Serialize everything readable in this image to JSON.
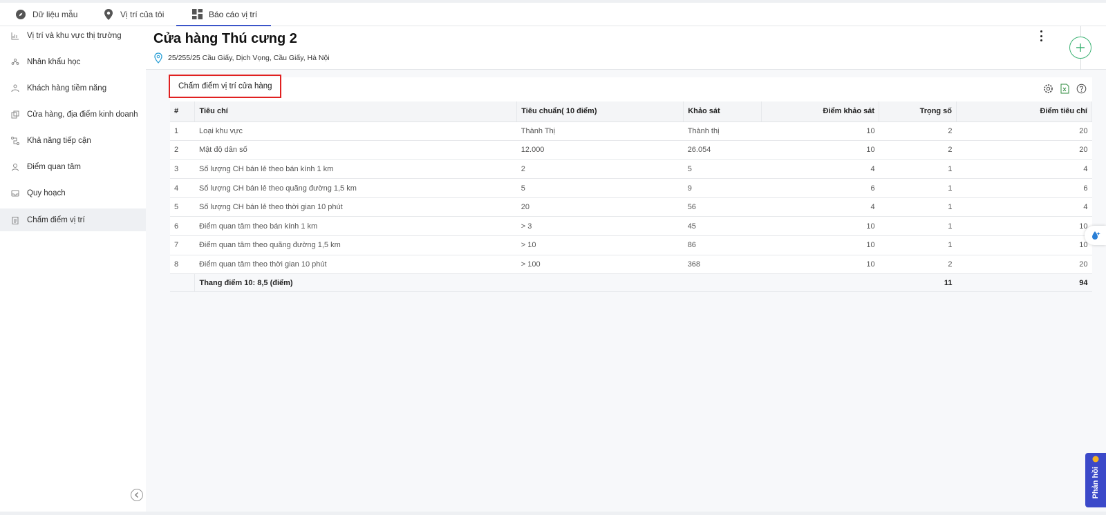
{
  "tabs": [
    {
      "label": "Dữ liệu mẫu",
      "icon": "compass-icon"
    },
    {
      "label": "Vị trí của tôi",
      "icon": "map-pin-icon"
    },
    {
      "label": "Báo cáo vị trí",
      "icon": "dashboard-icon",
      "active": true
    }
  ],
  "sidebar": {
    "items": [
      {
        "label": "Vị trí và khu vực thị trường",
        "icon": "chart-icon"
      },
      {
        "label": "Nhân khẩu học",
        "icon": "people-icon"
      },
      {
        "label": "Khách hàng tiềm năng",
        "icon": "users-icon"
      },
      {
        "label": "Cửa hàng, địa điểm kinh doanh",
        "icon": "store-icon"
      },
      {
        "label": "Khả năng tiếp cận",
        "icon": "route-icon"
      },
      {
        "label": "Điểm quan tâm",
        "icon": "person-icon"
      },
      {
        "label": "Quy hoạch",
        "icon": "inbox-icon"
      },
      {
        "label": "Chấm điểm vị trí",
        "icon": "clipboard-icon",
        "active": true
      }
    ]
  },
  "header": {
    "title": "Cửa hàng Thú cưng 2",
    "address": "25/255/25 Cầu Giấy, Dịch Vọng, Cầu Giấy, Hà Nội"
  },
  "card": {
    "title": "Chấm điểm vị trí cửa hàng",
    "columns": [
      "#",
      "Tiêu chí",
      "Tiêu chuẩn( 10 điểm)",
      "Khảo sát",
      "Điểm khảo sát",
      "Trọng số",
      "Điểm tiêu chí"
    ],
    "rows": [
      {
        "idx": "1",
        "criteria": "Loại khu vực",
        "standard": "Thành Thị",
        "survey": "Thành thị",
        "score": "10",
        "weight": "2",
        "total": "20"
      },
      {
        "idx": "2",
        "criteria": "Mật độ dân số",
        "standard": "12.000",
        "survey": "26.054",
        "score": "10",
        "weight": "2",
        "total": "20"
      },
      {
        "idx": "3",
        "criteria": "Số lượng CH bán lẻ theo bán kính 1 km",
        "standard": "2",
        "survey": "5",
        "score": "4",
        "weight": "1",
        "total": "4"
      },
      {
        "idx": "4",
        "criteria": "Số lượng CH bán lẻ theo quãng đường 1,5 km",
        "standard": "5",
        "survey": "9",
        "score": "6",
        "weight": "1",
        "total": "6"
      },
      {
        "idx": "5",
        "criteria": "Số lượng CH bán lẻ theo thời gian 10 phút",
        "standard": "20",
        "survey": "56",
        "score": "4",
        "weight": "1",
        "total": "4"
      },
      {
        "idx": "6",
        "criteria": "Điểm quan tâm theo bán kính 1 km",
        "standard": "> 3",
        "survey": "45",
        "score": "10",
        "weight": "1",
        "total": "10"
      },
      {
        "idx": "7",
        "criteria": "Điểm quan tâm theo quãng đường 1,5 km",
        "standard": "> 10",
        "survey": "86",
        "score": "10",
        "weight": "1",
        "total": "10"
      },
      {
        "idx": "8",
        "criteria": "Điểm quan tâm theo thời gian 10 phút",
        "standard": "> 100",
        "survey": "368",
        "score": "10",
        "weight": "2",
        "total": "20"
      }
    ],
    "footer": {
      "label": "Thang điểm 10: 8,5 (điểm)",
      "weight_sum": "11",
      "total_sum": "94"
    }
  },
  "feedback": {
    "label": "Phản hồi"
  },
  "colors": {
    "accent": "#3b55c9",
    "highlight": "#e02020",
    "fab": "#3bb273",
    "feedback": "#3b49c9"
  }
}
